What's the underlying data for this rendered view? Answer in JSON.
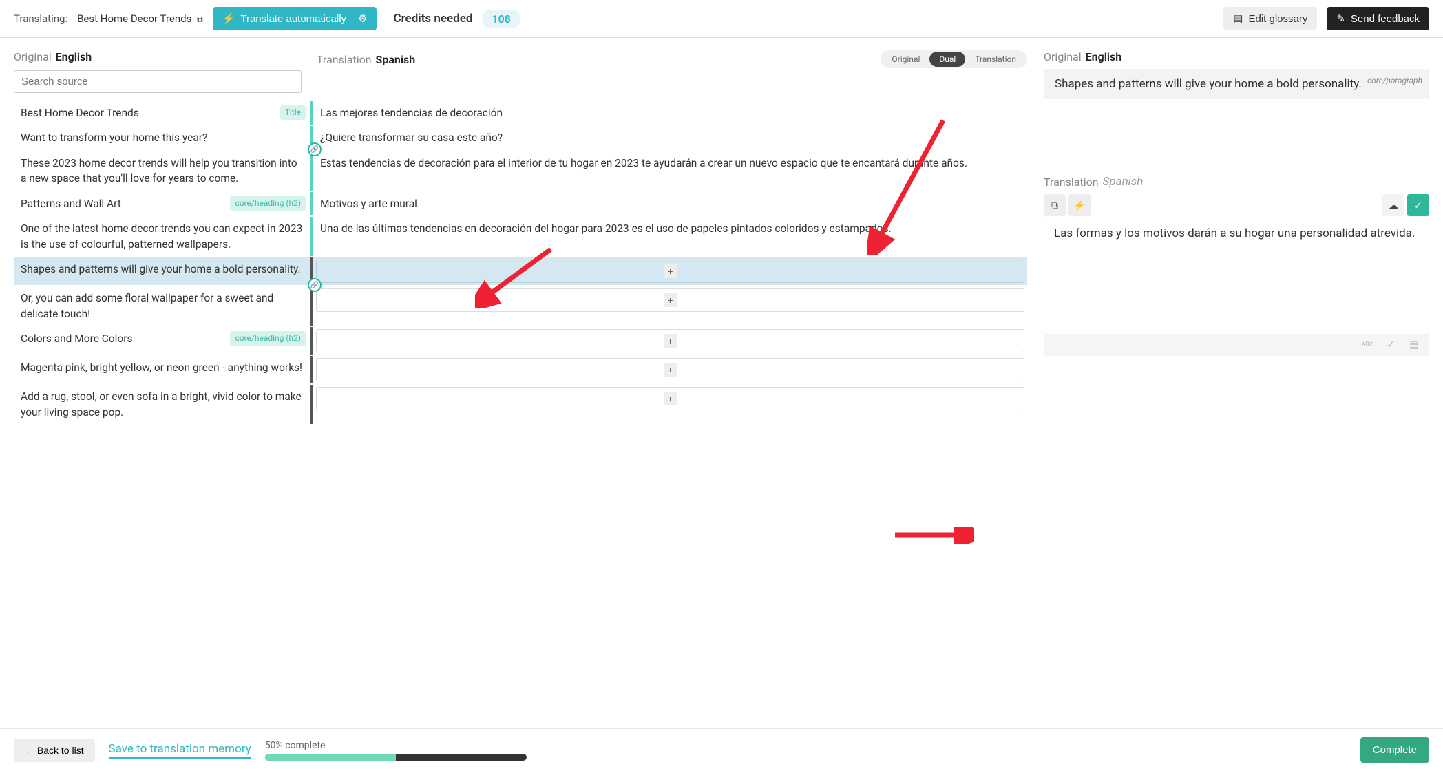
{
  "header": {
    "translating_label": "Translating:",
    "page_title": "Best Home Decor Trends",
    "translate_auto_label": "Translate automatically",
    "credits_label": "Credits needed",
    "credits_value": "108",
    "edit_glossary_label": "Edit glossary",
    "send_feedback_label": "Send feedback"
  },
  "columns": {
    "original_label": "Original",
    "original_lang": "English",
    "translation_label": "Translation",
    "translation_lang": "Spanish",
    "search_placeholder": "Search source"
  },
  "view_toggle": {
    "original": "Original",
    "dual": "Dual",
    "translation": "Translation"
  },
  "segments": [
    {
      "src": "Best Home Decor Trends",
      "badge": "Title",
      "dst": "Las mejores tendencias de decoración",
      "status": "translated"
    },
    {
      "src": "Want to transform your home this year?",
      "dst": "¿Quiere transformar su casa este año?",
      "status": "translated",
      "link_after": true
    },
    {
      "src": "These 2023 home decor trends will help you transition into a new space that you'll love for years to come.",
      "dst": "Estas tendencias de decoración para el interior de tu hogar en 2023 te ayudarán a crear un nuevo espacio que te encantará durante años.",
      "status": "translated"
    },
    {
      "src": "Patterns and Wall Art",
      "badge": "core/heading (h2)",
      "dst": "Motivos y arte mural",
      "status": "translated"
    },
    {
      "src": "One of the latest home decor trends you can expect in 2023 is the use of colourful, patterned wallpapers.",
      "dst": "Una de las últimas tendencias en decoración del hogar para 2023 es el uso de papeles pintados coloridos y estampados.",
      "status": "translated"
    },
    {
      "src": "Shapes and patterns will give your home a bold personality.",
      "dst": "",
      "status": "empty",
      "selected": true,
      "link_after": true
    },
    {
      "src": "Or, you can add some floral wallpaper for a sweet and delicate touch!",
      "dst": "",
      "status": "empty"
    },
    {
      "src": "Colors and More Colors",
      "badge": "core/heading (h2)",
      "dst": "",
      "status": "empty"
    },
    {
      "src": "Magenta pink, bright yellow, or neon green - anything works!",
      "dst": "",
      "status": "empty"
    },
    {
      "src": "Add a rug, stool, or even sofa in a bright, vivid color to make your living space pop.",
      "dst": "",
      "status": "empty"
    }
  ],
  "right_panel": {
    "original_label": "Original",
    "original_lang": "English",
    "original_text": "Shapes and patterns will give your home a bold personality.",
    "original_type": "core/paragraph",
    "translation_label": "Translation",
    "translation_lang": "Spanish",
    "translation_text": "Las formas y los motivos darán a su hogar una personalidad atrevida."
  },
  "footer": {
    "back_label": "← Back to list",
    "save_memory_label": "Save to translation memory",
    "progress_label": "50% complete",
    "progress_percent": 50,
    "complete_label": "Complete"
  }
}
